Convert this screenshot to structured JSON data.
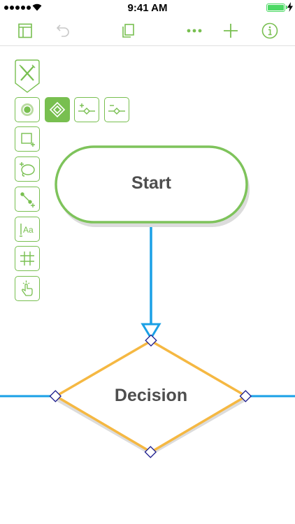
{
  "status_bar": {
    "time": "9:41 AM",
    "battery_level": 1.0,
    "network_icon": "wifi-icon"
  },
  "toolbar": {
    "left_icons": [
      "sidebar-icon",
      "undo-icon"
    ],
    "center_icon": "documents-icon",
    "right_icons": [
      "more-icon",
      "add-icon",
      "info-icon"
    ]
  },
  "palette": {
    "top_tool": "drawing-tools-icon",
    "tools": [
      "style-tool-icon",
      "selection-tool-icon",
      "add-connection-in-icon",
      "add-connection-out-icon",
      "shape-tool-icon",
      "lasso-tool-icon",
      "line-tool-icon",
      "text-tool-icon",
      "grid-tool-icon",
      "touch-tool-icon"
    ],
    "selected_tool": "selection-tool-icon"
  },
  "diagram": {
    "start_label": "Start",
    "decision_label": "Decision"
  },
  "colors": {
    "accent": "#78bf50",
    "connector": "#1aa0e6",
    "selection": "#f5b842",
    "handle": "#1a1a8c",
    "label": "#4e4e4e"
  }
}
